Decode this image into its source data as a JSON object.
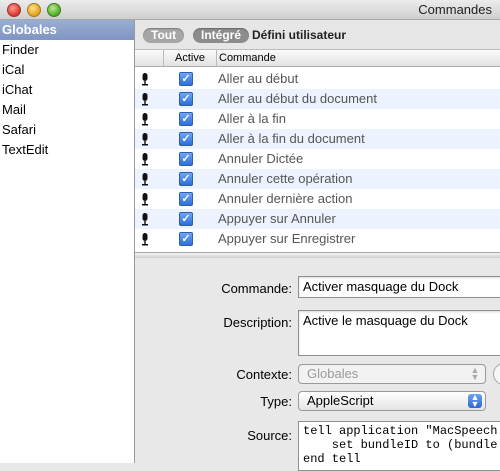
{
  "window": {
    "title": "Commandes"
  },
  "sidebar": {
    "items": [
      {
        "label": "Globales",
        "selected": true
      },
      {
        "label": "Finder"
      },
      {
        "label": "iCal"
      },
      {
        "label": "iChat"
      },
      {
        "label": "Mail"
      },
      {
        "label": "Safari"
      },
      {
        "label": "TextEdit"
      }
    ]
  },
  "filters": {
    "all": "Tout",
    "integrated": "Intégré",
    "user_defined": "Défini utilisateur"
  },
  "table": {
    "headers": {
      "active": "Active",
      "command": "Commande"
    },
    "rows": [
      {
        "name": "Aller au début",
        "active": true
      },
      {
        "name": "Aller au début du document",
        "active": true
      },
      {
        "name": "Aller à la fin",
        "active": true
      },
      {
        "name": "Aller à la fin du document",
        "active": true
      },
      {
        "name": "Annuler Dictée",
        "active": true
      },
      {
        "name": "Annuler cette opération",
        "active": true
      },
      {
        "name": "Annuler dernière action",
        "active": true
      },
      {
        "name": "Appuyer sur Annuler",
        "active": true
      },
      {
        "name": "Appuyer sur Enregistrer",
        "active": true
      }
    ]
  },
  "detail": {
    "command_label": "Commande:",
    "command_value": "Activer masquage du Dock",
    "description_label": "Description:",
    "description_value": "Active le masquage du Dock",
    "context_label": "Contexte:",
    "context_value": "Globales",
    "type_label": "Type:",
    "type_value": "AppleScript",
    "source_label": "Source:",
    "source_value": "tell application \"MacSpeech\n    set bundleID to (bundle\nend tell"
  },
  "colors": {
    "selection": "#8a9fca",
    "checkbox": "#2b6ed8",
    "row_alt": "#edf3fe"
  }
}
